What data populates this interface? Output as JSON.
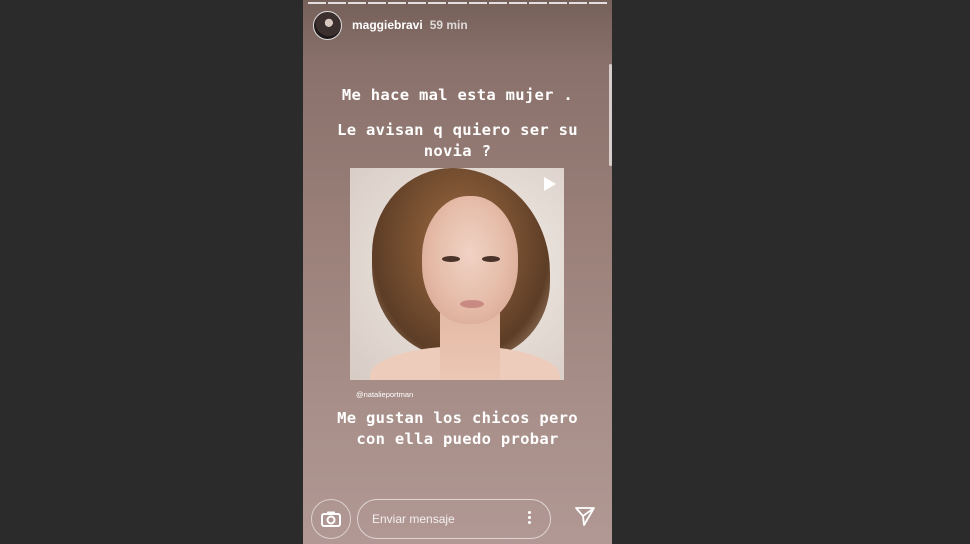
{
  "header": {
    "username": "maggiebravi",
    "time": "59 min"
  },
  "story": {
    "caption_1": "Me hace mal esta mujer .",
    "caption_2_line1": "Le avisan q quiero ser su",
    "caption_2_line2": "novia ?",
    "caption_3_line1": "Me gustan los chicos pero",
    "caption_3_line2": "con ella puedo probar",
    "mention": "@natalieportman",
    "progress_segments": 15
  },
  "reply": {
    "placeholder": "Enviar mensaje"
  },
  "icons": {
    "camera": "camera-icon",
    "more": "more-vertical-icon",
    "send": "send-icon",
    "play": "play-icon"
  }
}
